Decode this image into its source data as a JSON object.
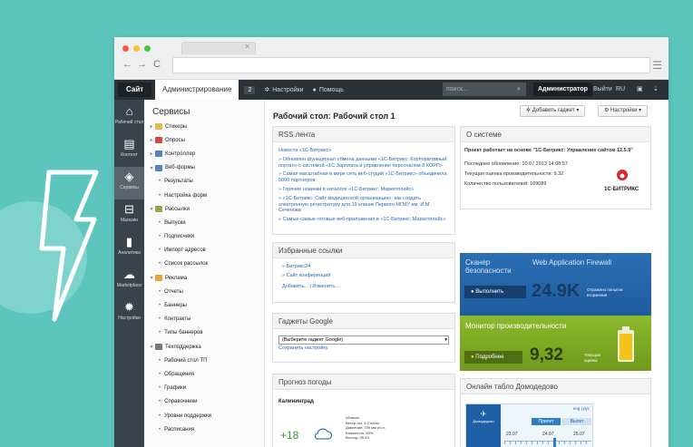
{
  "browser": {
    "tab_close": "×"
  },
  "topbar": {
    "site": "Сайт",
    "admin": "Администрирование",
    "notifications_count": "2",
    "settings": "Настройки",
    "help": "Помощь",
    "search_placeholder": "поиск...",
    "user": "Администратор",
    "logout": "Выйти",
    "lang": "RU"
  },
  "sidebar": {
    "items": [
      {
        "label": "Рабочий стол",
        "icon": "home-icon"
      },
      {
        "label": "Контент",
        "icon": "document-icon"
      },
      {
        "label": "Сервисы",
        "icon": "layers-icon"
      },
      {
        "label": "Магазин",
        "icon": "basket-icon"
      },
      {
        "label": "Аналитика",
        "icon": "bar-chart-icon"
      },
      {
        "label": "Marketplace",
        "icon": "cloud-icon"
      },
      {
        "label": "Настройки",
        "icon": "gear-icon"
      }
    ]
  },
  "tree": {
    "title": "Сервисы",
    "items": [
      {
        "label": "Стикеры",
        "level": 0,
        "arrow": "▸",
        "color": "#e8b84a"
      },
      {
        "label": "Опросы",
        "level": 0,
        "arrow": "▸",
        "color": "#d24b3f"
      },
      {
        "label": "Контроллер",
        "level": 0,
        "arrow": "▸",
        "color": "#5582c4"
      },
      {
        "label": "Веб-формы",
        "level": 0,
        "arrow": "▾",
        "color": "#5582c4"
      },
      {
        "label": "Результаты",
        "level": 1
      },
      {
        "label": "Настройка форм",
        "level": 1
      },
      {
        "label": "Рассылки",
        "level": 0,
        "arrow": "▾",
        "color": "#8ea84a"
      },
      {
        "label": "Выпуски",
        "level": 1
      },
      {
        "label": "Подписчики",
        "level": 1
      },
      {
        "label": "Импорт адресов",
        "level": 1
      },
      {
        "label": "Список рассылок",
        "level": 1
      },
      {
        "label": "Реклама",
        "level": 0,
        "arrow": "▾",
        "color": "#e8a33a"
      },
      {
        "label": "Отчеты",
        "level": 1
      },
      {
        "label": "Баннеры",
        "level": 1
      },
      {
        "label": "Контракты",
        "level": 1
      },
      {
        "label": "Типы баннеров",
        "level": 1
      },
      {
        "label": "Техподдержка",
        "level": 0,
        "arrow": "▾",
        "color": "#777777"
      },
      {
        "label": "Рабочий стол ТП",
        "level": 1
      },
      {
        "label": "Обращения",
        "level": 1
      },
      {
        "label": "Графики",
        "level": 1
      },
      {
        "label": "Справочники",
        "level": 1
      },
      {
        "label": "Уровни поддержки",
        "level": 1
      },
      {
        "label": "Расписания",
        "level": 1
      }
    ]
  },
  "main": {
    "title": "Рабочий стол: Рабочий стол 1",
    "add_gadget": "Добавить гаджет",
    "settings": "Настройки"
  },
  "rss": {
    "title": "RSS лента",
    "items": [
      "Новости «1С-Битрикс»",
      "» Обновлен функционал обмена данными «1С-Битрикс: Корпоративный портал» с системой «1С:Зарплата и управление персоналом 8 КОРП»",
      "» Самая масштабная в мире сеть веб-студий «1С-Битрикс» объединила 5000 партнеров",
      "» Горячие новинки в каталоге «1С-Битрикс: Маркетплейс»",
      "» «1С-Битрикс: Сайт медицинской организации»: как создать электронную регистратуру для 19 клиник Первого МГМУ им. И.М. Сеченова",
      "» Самые-самые готовые веб-приложения в «1С-Битрикс: Маркетплейс»"
    ]
  },
  "favorites": {
    "title": "Избранные ссылки",
    "links": [
      "» Битрикс24",
      "» Сайт конференций"
    ],
    "actions": "Добавить... | Изменить..."
  },
  "google": {
    "title": "Гаджеты Google",
    "select": "(Выберите гаджет Google)",
    "save": "Сохранить настройку"
  },
  "weather": {
    "title": "Прогноз погоды",
    "city": "Калининград",
    "temp": "+18",
    "details": [
      "облачно",
      "Ветер: юз, 4.0 м/сек",
      "Давление: 759 мм рт.ст.",
      "Влажность: 83%",
      "Восход: 05:33"
    ]
  },
  "system": {
    "title": "О системе",
    "based_on": "Проект работает на основе \"1С-Битрикс: Управление сайтом 12.5.9\"",
    "last_update": "Последнее обновление: 10.07.2013 14:08:57",
    "score": "Текущая оценка производительности: 9.32",
    "users": "Количество пользователей: 109089",
    "logo": "1С-БИТРИКС"
  },
  "scanner": {
    "title": "Сканер безопасности",
    "subtitle": "Web Application Firewall",
    "button": "Выполнить",
    "value": "24.9K",
    "note": "Отражено попыток вторжения"
  },
  "monitor": {
    "title": "Монитор производительности",
    "button": "Подробнее",
    "value": "9,32",
    "note": "Текущая оценка"
  },
  "airport": {
    "title": "Онлайн табло Домодедово",
    "brand": "Домодедово",
    "lang": "eng | рус",
    "arrival": "Прилет",
    "departure": "Вылет",
    "dates": [
      "23.07",
      "24.07",
      "25.07"
    ]
  }
}
